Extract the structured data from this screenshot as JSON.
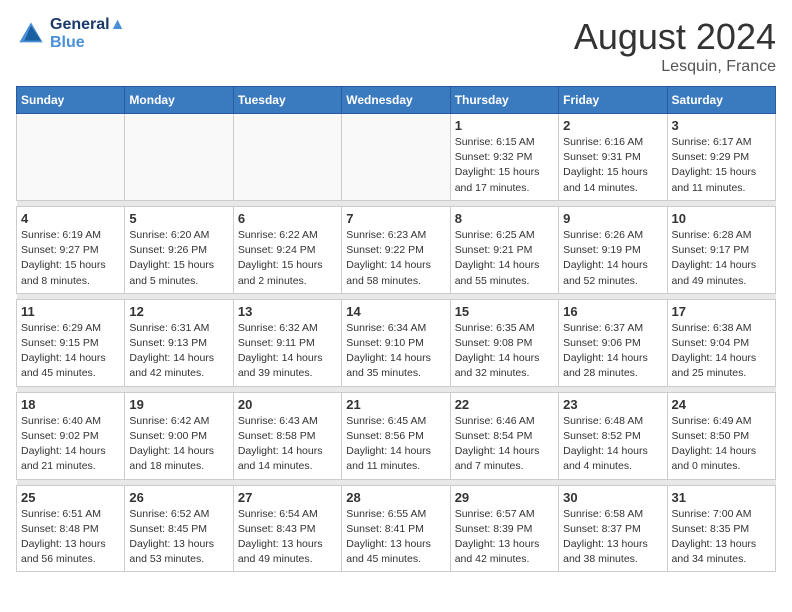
{
  "header": {
    "logo_line1": "General",
    "logo_line2": "Blue",
    "month_year": "August 2024",
    "location": "Lesquin, France"
  },
  "weekdays": [
    "Sunday",
    "Monday",
    "Tuesday",
    "Wednesday",
    "Thursday",
    "Friday",
    "Saturday"
  ],
  "weeks": [
    [
      {
        "day": "",
        "info": ""
      },
      {
        "day": "",
        "info": ""
      },
      {
        "day": "",
        "info": ""
      },
      {
        "day": "",
        "info": ""
      },
      {
        "day": "1",
        "info": "Sunrise: 6:15 AM\nSunset: 9:32 PM\nDaylight: 15 hours\nand 17 minutes."
      },
      {
        "day": "2",
        "info": "Sunrise: 6:16 AM\nSunset: 9:31 PM\nDaylight: 15 hours\nand 14 minutes."
      },
      {
        "day": "3",
        "info": "Sunrise: 6:17 AM\nSunset: 9:29 PM\nDaylight: 15 hours\nand 11 minutes."
      }
    ],
    [
      {
        "day": "4",
        "info": "Sunrise: 6:19 AM\nSunset: 9:27 PM\nDaylight: 15 hours\nand 8 minutes."
      },
      {
        "day": "5",
        "info": "Sunrise: 6:20 AM\nSunset: 9:26 PM\nDaylight: 15 hours\nand 5 minutes."
      },
      {
        "day": "6",
        "info": "Sunrise: 6:22 AM\nSunset: 9:24 PM\nDaylight: 15 hours\nand 2 minutes."
      },
      {
        "day": "7",
        "info": "Sunrise: 6:23 AM\nSunset: 9:22 PM\nDaylight: 14 hours\nand 58 minutes."
      },
      {
        "day": "8",
        "info": "Sunrise: 6:25 AM\nSunset: 9:21 PM\nDaylight: 14 hours\nand 55 minutes."
      },
      {
        "day": "9",
        "info": "Sunrise: 6:26 AM\nSunset: 9:19 PM\nDaylight: 14 hours\nand 52 minutes."
      },
      {
        "day": "10",
        "info": "Sunrise: 6:28 AM\nSunset: 9:17 PM\nDaylight: 14 hours\nand 49 minutes."
      }
    ],
    [
      {
        "day": "11",
        "info": "Sunrise: 6:29 AM\nSunset: 9:15 PM\nDaylight: 14 hours\nand 45 minutes."
      },
      {
        "day": "12",
        "info": "Sunrise: 6:31 AM\nSunset: 9:13 PM\nDaylight: 14 hours\nand 42 minutes."
      },
      {
        "day": "13",
        "info": "Sunrise: 6:32 AM\nSunset: 9:11 PM\nDaylight: 14 hours\nand 39 minutes."
      },
      {
        "day": "14",
        "info": "Sunrise: 6:34 AM\nSunset: 9:10 PM\nDaylight: 14 hours\nand 35 minutes."
      },
      {
        "day": "15",
        "info": "Sunrise: 6:35 AM\nSunset: 9:08 PM\nDaylight: 14 hours\nand 32 minutes."
      },
      {
        "day": "16",
        "info": "Sunrise: 6:37 AM\nSunset: 9:06 PM\nDaylight: 14 hours\nand 28 minutes."
      },
      {
        "day": "17",
        "info": "Sunrise: 6:38 AM\nSunset: 9:04 PM\nDaylight: 14 hours\nand 25 minutes."
      }
    ],
    [
      {
        "day": "18",
        "info": "Sunrise: 6:40 AM\nSunset: 9:02 PM\nDaylight: 14 hours\nand 21 minutes."
      },
      {
        "day": "19",
        "info": "Sunrise: 6:42 AM\nSunset: 9:00 PM\nDaylight: 14 hours\nand 18 minutes."
      },
      {
        "day": "20",
        "info": "Sunrise: 6:43 AM\nSunset: 8:58 PM\nDaylight: 14 hours\nand 14 minutes."
      },
      {
        "day": "21",
        "info": "Sunrise: 6:45 AM\nSunset: 8:56 PM\nDaylight: 14 hours\nand 11 minutes."
      },
      {
        "day": "22",
        "info": "Sunrise: 6:46 AM\nSunset: 8:54 PM\nDaylight: 14 hours\nand 7 minutes."
      },
      {
        "day": "23",
        "info": "Sunrise: 6:48 AM\nSunset: 8:52 PM\nDaylight: 14 hours\nand 4 minutes."
      },
      {
        "day": "24",
        "info": "Sunrise: 6:49 AM\nSunset: 8:50 PM\nDaylight: 14 hours\nand 0 minutes."
      }
    ],
    [
      {
        "day": "25",
        "info": "Sunrise: 6:51 AM\nSunset: 8:48 PM\nDaylight: 13 hours\nand 56 minutes."
      },
      {
        "day": "26",
        "info": "Sunrise: 6:52 AM\nSunset: 8:45 PM\nDaylight: 13 hours\nand 53 minutes."
      },
      {
        "day": "27",
        "info": "Sunrise: 6:54 AM\nSunset: 8:43 PM\nDaylight: 13 hours\nand 49 minutes."
      },
      {
        "day": "28",
        "info": "Sunrise: 6:55 AM\nSunset: 8:41 PM\nDaylight: 13 hours\nand 45 minutes."
      },
      {
        "day": "29",
        "info": "Sunrise: 6:57 AM\nSunset: 8:39 PM\nDaylight: 13 hours\nand 42 minutes."
      },
      {
        "day": "30",
        "info": "Sunrise: 6:58 AM\nSunset: 8:37 PM\nDaylight: 13 hours\nand 38 minutes."
      },
      {
        "day": "31",
        "info": "Sunrise: 7:00 AM\nSunset: 8:35 PM\nDaylight: 13 hours\nand 34 minutes."
      }
    ]
  ]
}
